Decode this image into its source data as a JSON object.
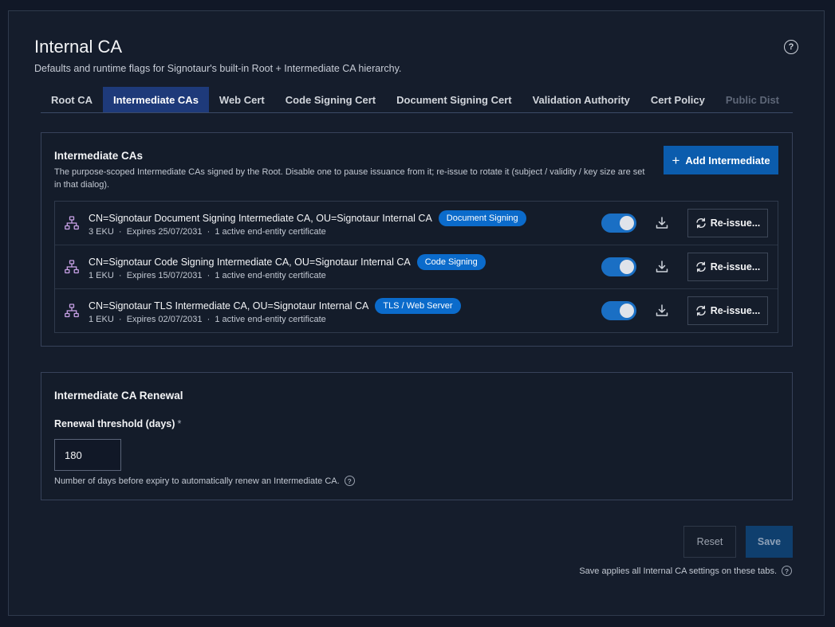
{
  "header": {
    "title": "Internal CA",
    "subtitle": "Defaults and runtime flags for Signotaur's built-in Root + Intermediate CA hierarchy."
  },
  "tabs": [
    {
      "label": "Root CA",
      "state": "normal"
    },
    {
      "label": "Intermediate CAs",
      "state": "active"
    },
    {
      "label": "Web Cert",
      "state": "normal"
    },
    {
      "label": "Code Signing Cert",
      "state": "normal"
    },
    {
      "label": "Document Signing Cert",
      "state": "normal"
    },
    {
      "label": "Validation Authority",
      "state": "normal"
    },
    {
      "label": "Cert Policy",
      "state": "normal"
    },
    {
      "label": "Public Dist",
      "state": "disabled"
    }
  ],
  "intermediates": {
    "title": "Intermediate CAs",
    "description": "The purpose-scoped Intermediate CAs signed by the Root. Disable one to pause issuance from it; re-issue to rotate it (subject / validity / key size are set in that dialog).",
    "add_label": "Add Intermediate",
    "reissue_label": "Re-issue...",
    "items": [
      {
        "name": "CN=Signotaur Document Signing Intermediate CA, OU=Signotaur Internal CA",
        "badge": "Document Signing",
        "eku": "3 EKU",
        "expires": "Expires 25/07/2031",
        "certs": "1 active end-entity certificate",
        "enabled": true
      },
      {
        "name": "CN=Signotaur Code Signing Intermediate CA, OU=Signotaur Internal CA",
        "badge": "Code Signing",
        "eku": "1 EKU",
        "expires": "Expires 15/07/2031",
        "certs": "1 active end-entity certificate",
        "enabled": true
      },
      {
        "name": "CN=Signotaur TLS Intermediate CA, OU=Signotaur Internal CA",
        "badge": "TLS / Web Server",
        "eku": "1 EKU",
        "expires": "Expires 02/07/2031",
        "certs": "1 active end-entity certificate",
        "enabled": true
      }
    ]
  },
  "renewal": {
    "title": "Intermediate CA Renewal",
    "label": "Renewal threshold (days)",
    "required_mark": "*",
    "value": "180",
    "hint": "Number of days before expiry to automatically renew an Intermediate CA."
  },
  "footer": {
    "reset_label": "Reset",
    "save_label": "Save",
    "note": "Save applies all Internal CA settings on these tabs."
  },
  "colors": {
    "accent": "#0b5cad",
    "active_tab": "#1e3a7a",
    "toggle_on": "#1a6fc4",
    "badge": "#0b6bcb",
    "hierarchy_icon": "#c9a2e8"
  },
  "icons": {
    "help": "question-circle-icon",
    "row": "hierarchy-icon",
    "download": "download-icon",
    "reissue": "refresh-icon",
    "add": "plus-icon"
  }
}
